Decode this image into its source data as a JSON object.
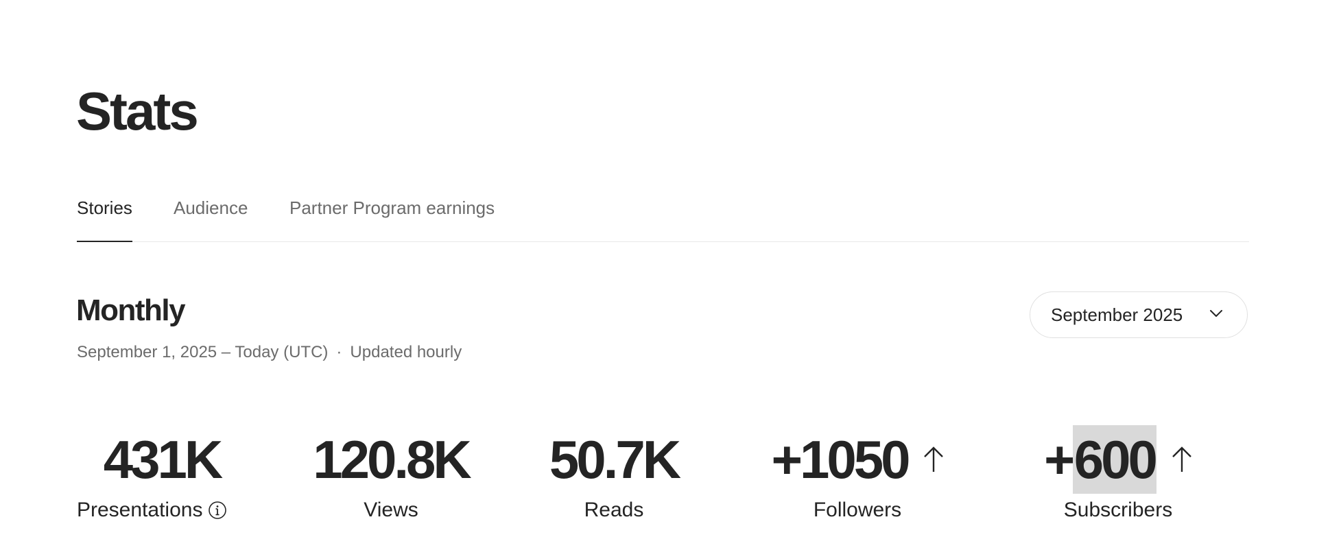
{
  "header": {
    "title": "Stats"
  },
  "tabs": [
    {
      "label": "Stories",
      "active": true
    },
    {
      "label": "Audience",
      "active": false
    },
    {
      "label": "Partner Program earnings",
      "active": false
    }
  ],
  "period": {
    "title": "Monthly",
    "date_range": "September 1, 2025 – Today (UTC)",
    "separator": "·",
    "update_note": "Updated hourly",
    "selector": {
      "selected": "September 2025",
      "icon": "chevron-down-icon"
    }
  },
  "stats": {
    "presentations": {
      "value": "431K",
      "label": "Presentations",
      "icon": "info-icon"
    },
    "views": {
      "value": "120.8K",
      "label": "Views"
    },
    "reads": {
      "value": "50.7K",
      "label": "Reads"
    },
    "followers": {
      "sign": "+",
      "value": "1050",
      "label": "Followers",
      "trend_icon": "arrow-up-icon"
    },
    "subscribers": {
      "sign": "+",
      "value": "600",
      "label": "Subscribers",
      "trend_icon": "arrow-up-icon",
      "value_highlighted": true
    }
  },
  "colors": {
    "text_primary": "#242424",
    "text_secondary": "#6b6b6b",
    "divider": "#e8e8e8",
    "highlight": "#d9d9d9"
  }
}
